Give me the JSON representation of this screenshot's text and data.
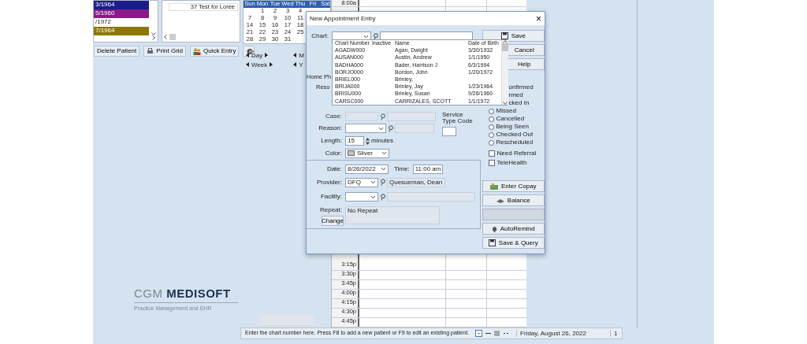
{
  "patients": [
    {
      "dob": "3/1964",
      "color": "#1c1c8a"
    },
    {
      "dob": "5/1960",
      "color": "#8a1a8a"
    },
    {
      "dob": "/1972",
      "color": "#ffffff"
    },
    {
      "dob": "7/1964",
      "color": "#8c7800"
    }
  ],
  "list_row": {
    "text": "37 Test for Loree"
  },
  "toolbar": [
    {
      "label": "Delete Patient",
      "kind": "text"
    },
    {
      "label": "Print Grid",
      "kind": "printer"
    },
    {
      "label": "Quick Entry",
      "kind": "person"
    },
    {
      "kind": "partial"
    }
  ],
  "calendar": {
    "days": [
      "Sun",
      "Mon",
      "Tue",
      "Wed",
      "Thu",
      "Fri",
      "Sat"
    ],
    "weeks": [
      {
        "kind": "lead",
        "days": [
          "1",
          "2",
          "3",
          "4"
        ]
      },
      {
        "kind": "full",
        "days": [
          "7",
          "8",
          "9",
          "10",
          "11"
        ]
      },
      {
        "kind": "full",
        "days": [
          "14",
          "15",
          "16",
          "17",
          "18"
        ]
      },
      {
        "kind": "full",
        "days": [
          "21",
          "22",
          "23",
          "24",
          "25"
        ]
      },
      {
        "kind": "full",
        "days": [
          "28",
          "29",
          "30",
          "31"
        ]
      }
    ]
  },
  "nav": [
    {
      "label": "Day"
    },
    {
      "label": "Week"
    }
  ],
  "nav_partial": [
    {
      "label": "M"
    },
    {
      "label": "Y"
    }
  ],
  "logo": {
    "brand": "CGM",
    "product": "MEDISOFT",
    "tagline": "Practice Management and EHR"
  },
  "schedule": {
    "top_times": [
      "8:00a"
    ],
    "bottom_times": [
      "3:15p",
      "3:30p",
      "3:45p",
      "4:00p",
      "4:15p",
      "4:30p",
      "4:45p"
    ]
  },
  "dialog": {
    "title": "New Appointment Entry",
    "close": "×",
    "chart": {
      "label": "Chart:"
    },
    "lookup": {
      "columns": [
        "Chart Number",
        "Inactive",
        "Name",
        "Date of Birth"
      ],
      "rows": [
        {
          "chart": "AGADW000",
          "name": "Agan, Dwight",
          "dob": "3/30/1932"
        },
        {
          "chart": "AUSAN000",
          "name": "Austin, Andrew",
          "dob": "1/1/1950"
        },
        {
          "chart": "BADHA000",
          "name": "Bader, Harrison J",
          "dob": "6/3/1994"
        },
        {
          "chart": "BORJO000",
          "name": "Bordon, John",
          "dob": "1/20/1972"
        },
        {
          "chart": "BRIEL000",
          "name": "Brinley,"
        },
        {
          "chart": "BRIJA000",
          "name": "Brinley, Jay",
          "dob": "1/23/1964"
        },
        {
          "chart": "BRISU000",
          "name": "Brinley, Susan",
          "dob": "9/26/1960"
        },
        {
          "chart": "CARSC000",
          "name": "CARRIZALES, SCOTT",
          "dob": "1/1/1972"
        }
      ]
    },
    "hidden_labels": [
      "Home Ph",
      "Reso"
    ],
    "case": {
      "label": "Case:",
      "disabled": true
    },
    "reason": {
      "label": "Reason:"
    },
    "service": {
      "label": "Service Type Code"
    },
    "length": {
      "label": "Length:",
      "value": "15",
      "unit": "minutes"
    },
    "color": {
      "label": "Color:",
      "value": "Silver"
    },
    "date": {
      "label": "Date:",
      "value": "8/26/2022"
    },
    "time": {
      "label": "Time:",
      "value": "11:00 am"
    },
    "provider": {
      "label": "Provider:",
      "value": "DFQ",
      "name": "Quesueman, Dean"
    },
    "facility": {
      "label": "Facility:"
    },
    "repeat": {
      "label": "Repeat:",
      "value": "No Repeat",
      "button": "Change"
    },
    "top_buttons": [
      {
        "label": "Save",
        "kind": "save"
      },
      {
        "label": "Cancel",
        "kind": "plain"
      },
      {
        "label": "Help",
        "kind": "plain"
      }
    ],
    "statuses": [
      {
        "label": "onfirmed",
        "kind": "partial"
      },
      {
        "label": "rmed",
        "kind": "partial"
      },
      {
        "label": "cked In",
        "kind": "partial"
      },
      {
        "label": "Missed",
        "kind": "radio",
        "selected": false
      },
      {
        "label": "Cancelled",
        "kind": "radio",
        "selected": false
      },
      {
        "label": "Being Seen",
        "kind": "radio",
        "selected": false
      },
      {
        "label": "Checked Out",
        "kind": "radio",
        "selected": false
      },
      {
        "label": "Rescheduled",
        "kind": "radio",
        "selected": false
      }
    ],
    "checks": [
      {
        "label": "Need Referral",
        "checked": false
      },
      {
        "label": "TeleHealth",
        "checked": false
      }
    ],
    "bottom_buttons": [
      {
        "label": "Enter Copay",
        "kind": "copay",
        "disabled": false
      },
      {
        "label": "Balance",
        "kind": "balance",
        "disabled": false
      },
      {
        "kind": "plain",
        "disabled": true
      },
      {
        "label": "AutoRemind",
        "kind": "remind",
        "disabled": false
      },
      {
        "label": "Save & Query",
        "kind": "save",
        "disabled": false
      }
    ]
  },
  "status_bar": {
    "message": "Enter the chart number here.  Press F8 to add a new patient or F9 to edit an existing patient.",
    "date": "Friday, August 26, 2022",
    "count": "1"
  }
}
